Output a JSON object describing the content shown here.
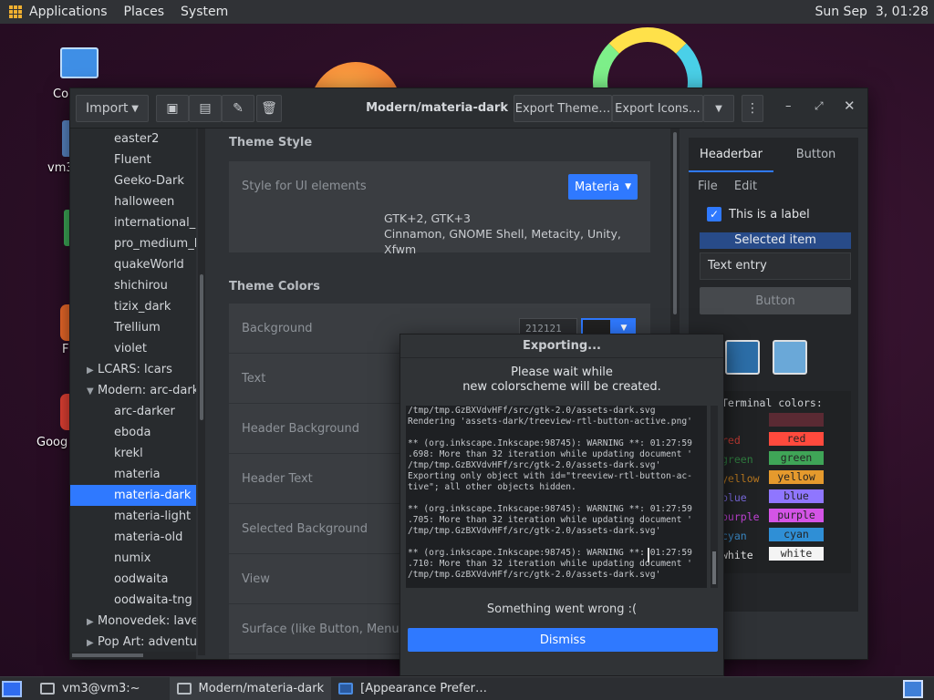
{
  "top_panel": {
    "menus": [
      "Applications",
      "Places",
      "System"
    ],
    "clock": "Sun Sep  3, 01:28"
  },
  "desktop": {
    "icons": [
      "Co",
      "vm3",
      "F",
      "Goog"
    ]
  },
  "window": {
    "title": "Modern/materia-dark",
    "import_label": "Import",
    "export_theme_label": "Export Theme…",
    "export_icons_label": "Export Icons…"
  },
  "sidebar": {
    "items": [
      {
        "label": "easter2",
        "indent": 2
      },
      {
        "label": "Fluent",
        "indent": 2
      },
      {
        "label": "Geeko-Dark",
        "indent": 2
      },
      {
        "label": "halloween",
        "indent": 2
      },
      {
        "label": "international_a",
        "indent": 2
      },
      {
        "label": "pro_medium_l",
        "indent": 2
      },
      {
        "label": "quakeWorld",
        "indent": 2
      },
      {
        "label": "shichirou",
        "indent": 2
      },
      {
        "label": "tizix_dark",
        "indent": 2
      },
      {
        "label": "Trellium",
        "indent": 2
      },
      {
        "label": "violet",
        "indent": 2
      },
      {
        "label": "LCARS: lcars",
        "indent": 1,
        "caret": "▶"
      },
      {
        "label": "Modern: arc-dark",
        "indent": 1,
        "caret": "▼"
      },
      {
        "label": "arc-darker",
        "indent": 2
      },
      {
        "label": "eboda",
        "indent": 2
      },
      {
        "label": "krekl",
        "indent": 2
      },
      {
        "label": "materia",
        "indent": 2
      },
      {
        "label": "materia-dark",
        "indent": 2,
        "selected": true
      },
      {
        "label": "materia-light",
        "indent": 2
      },
      {
        "label": "materia-old",
        "indent": 2
      },
      {
        "label": "numix",
        "indent": 2
      },
      {
        "label": "oodwaita",
        "indent": 2
      },
      {
        "label": "oodwaita-tng",
        "indent": 2
      },
      {
        "label": "Monovedek: laver",
        "indent": 1,
        "caret": "▶"
      },
      {
        "label": "Pop Art: adventur",
        "indent": 1,
        "caret": "▶"
      }
    ]
  },
  "theme_style": {
    "title": "Theme Style",
    "row_label": "Style for UI elements",
    "combo_value": "Materia",
    "support_line1": "GTK+2, GTK+3",
    "support_line2": "Cinnamon, GNOME Shell, Metacity, Unity, Xfwm"
  },
  "theme_colors": {
    "title": "Theme Colors",
    "rows": [
      "Background",
      "Text",
      "Header Background",
      "Header Text",
      "Selected Background",
      "View",
      "Surface (like Button, Menu, Po"
    ],
    "background_value": "212121"
  },
  "preview": {
    "tabs": [
      "Headerbar",
      "Button"
    ],
    "menu": [
      "File",
      "Edit"
    ],
    "checkbox_label": "This is a label",
    "selected_item": "Selected item",
    "text_entry": "Text entry",
    "button_label": "Button",
    "terminal_title": "Terminal colors:",
    "terminal_colors": [
      {
        "left": "",
        "right": "",
        "color": "#5a2a33",
        "text": "#5a2a33"
      },
      {
        "left": "red",
        "right": "red",
        "color": "#ff4a3d",
        "text": "#c23b33"
      },
      {
        "left": "green",
        "right": "green",
        "color": "#3fa557",
        "text": "#2f7d3f"
      },
      {
        "left": "yellow",
        "right": "yellow",
        "color": "#e59a2d",
        "text": "#b7771f"
      },
      {
        "left": "blue",
        "right": "blue",
        "color": "#8f76ff",
        "text": "#7b6be0"
      },
      {
        "left": "purple",
        "right": "purple",
        "color": "#d454e6",
        "text": "#c142d6"
      },
      {
        "left": "cyan",
        "right": "cyan",
        "color": "#2f8fd6",
        "text": "#3b8bc8"
      },
      {
        "left": "white",
        "right": "white",
        "color": "#f4f4f4",
        "text": "#e6e6e6"
      }
    ]
  },
  "dialog": {
    "title": "Exporting...",
    "message_line1": "Please wait while",
    "message_line2": "new colorscheme will be created.",
    "log": [
      "/tmp/tmp.GzBXVdvHFf/src/gtk-2.0/assets-dark.svg",
      "Rendering 'assets-dark/treeview-rtl-button-active.png'",
      "",
      "** (org.inkscape.Inkscape:98745): WARNING **: 01:27:59",
      ".698: More than 32 iteration while updating document '",
      "/tmp/tmp.GzBXVdvHFf/src/gtk-2.0/assets-dark.svg'",
      "Exporting only object with id=\"treeview-rtl-button-ac-",
      "tive\"; all other objects hidden.",
      "",
      "** (org.inkscape.Inkscape:98745): WARNING **: 01:27:59",
      ".705: More than 32 iteration while updating document '",
      "/tmp/tmp.GzBXVdvHFf/src/gtk-2.0/assets-dark.svg'",
      "",
      "** (org.inkscape.Inkscape:98745): WARNING **: 01:27:59",
      ".710: More than 32 iteration while updating document '",
      "/tmp/tmp.GzBXVdvHFf/src/gtk-2.0/assets-dark.svg'"
    ],
    "error": "Something went wrong :(",
    "dismiss_label": "Dismiss"
  },
  "taskbar": {
    "tasks": [
      "vm3@vm3:~",
      "Modern/materia-dark",
      "[Appearance Prefer…"
    ]
  },
  "colors": {
    "accent": "#2f79ff",
    "panel": "#303236"
  }
}
